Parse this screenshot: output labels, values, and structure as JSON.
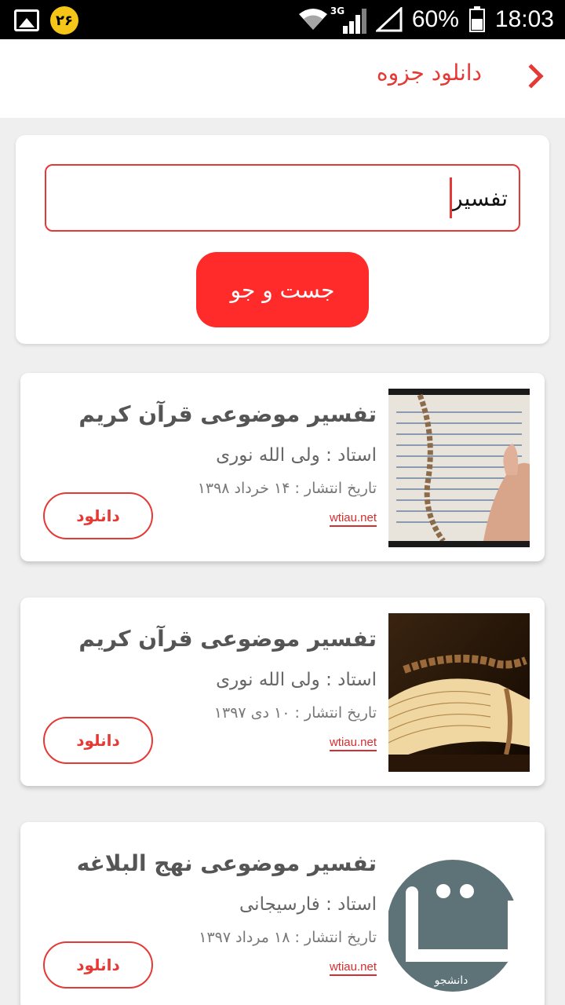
{
  "status_bar": {
    "badge": "۲۶",
    "network": "3G",
    "battery_percent": "60%",
    "time": "18:03"
  },
  "header": {
    "title": "دانلود جزوه"
  },
  "search": {
    "value": "تفسیر",
    "button_label": "جست و جو"
  },
  "results": [
    {
      "title": "تفسیر موضوعی قرآن کریم",
      "professor": "استاد : ولی الله نوری",
      "date": "تاریخ انتشار : ۱۴ خرداد ۱۳۹۸",
      "site": "wtiau.net",
      "download_label": "دانلود"
    },
    {
      "title": "تفسیر موضوعی قرآن کریم",
      "professor": "استاد : ولی الله نوری",
      "date": "تاریخ انتشار : ۱۰ دی ۱۳۹۷",
      "site": "wtiau.net",
      "download_label": "دانلود"
    },
    {
      "title": "تفسیر موضوعی نهج البلاغه",
      "professor": "استاد : فارسیجانی",
      "date": "تاریخ انتشار : ۱۸ مرداد ۱۳۹۷",
      "site": "wtiau.net",
      "download_label": "دانلود",
      "logo_text": "دانشجو"
    }
  ],
  "colors": {
    "accent": "#e53935",
    "search_button": "#ff2a2a",
    "background": "#efefef"
  }
}
